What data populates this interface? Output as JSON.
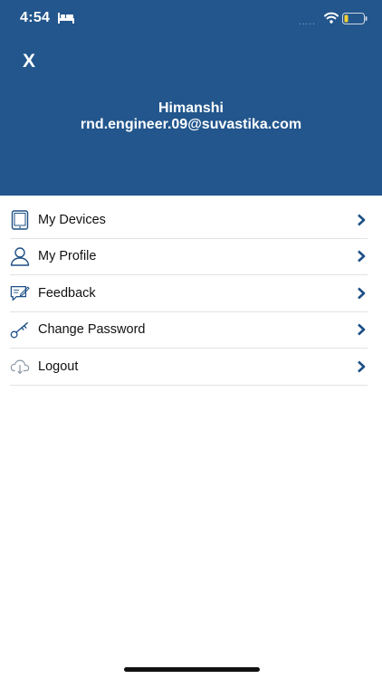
{
  "status_bar": {
    "time": "4:54",
    "signal": "....."
  },
  "header": {
    "close_label": "X",
    "user_name": "Himanshi",
    "user_email": "rnd.engineer.09@suvastika.com"
  },
  "menu": {
    "items": [
      {
        "label": "My Devices",
        "icon": "tablet-icon"
      },
      {
        "label": "My Profile",
        "icon": "user-icon"
      },
      {
        "label": "Feedback",
        "icon": "feedback-icon"
      },
      {
        "label": "Change Password",
        "icon": "key-icon"
      },
      {
        "label": "Logout",
        "icon": "cloud-icon"
      }
    ]
  },
  "colors": {
    "header_bg": "#22568c",
    "chevron": "#1d4f86",
    "icon_stroke": "#1d4f86"
  }
}
